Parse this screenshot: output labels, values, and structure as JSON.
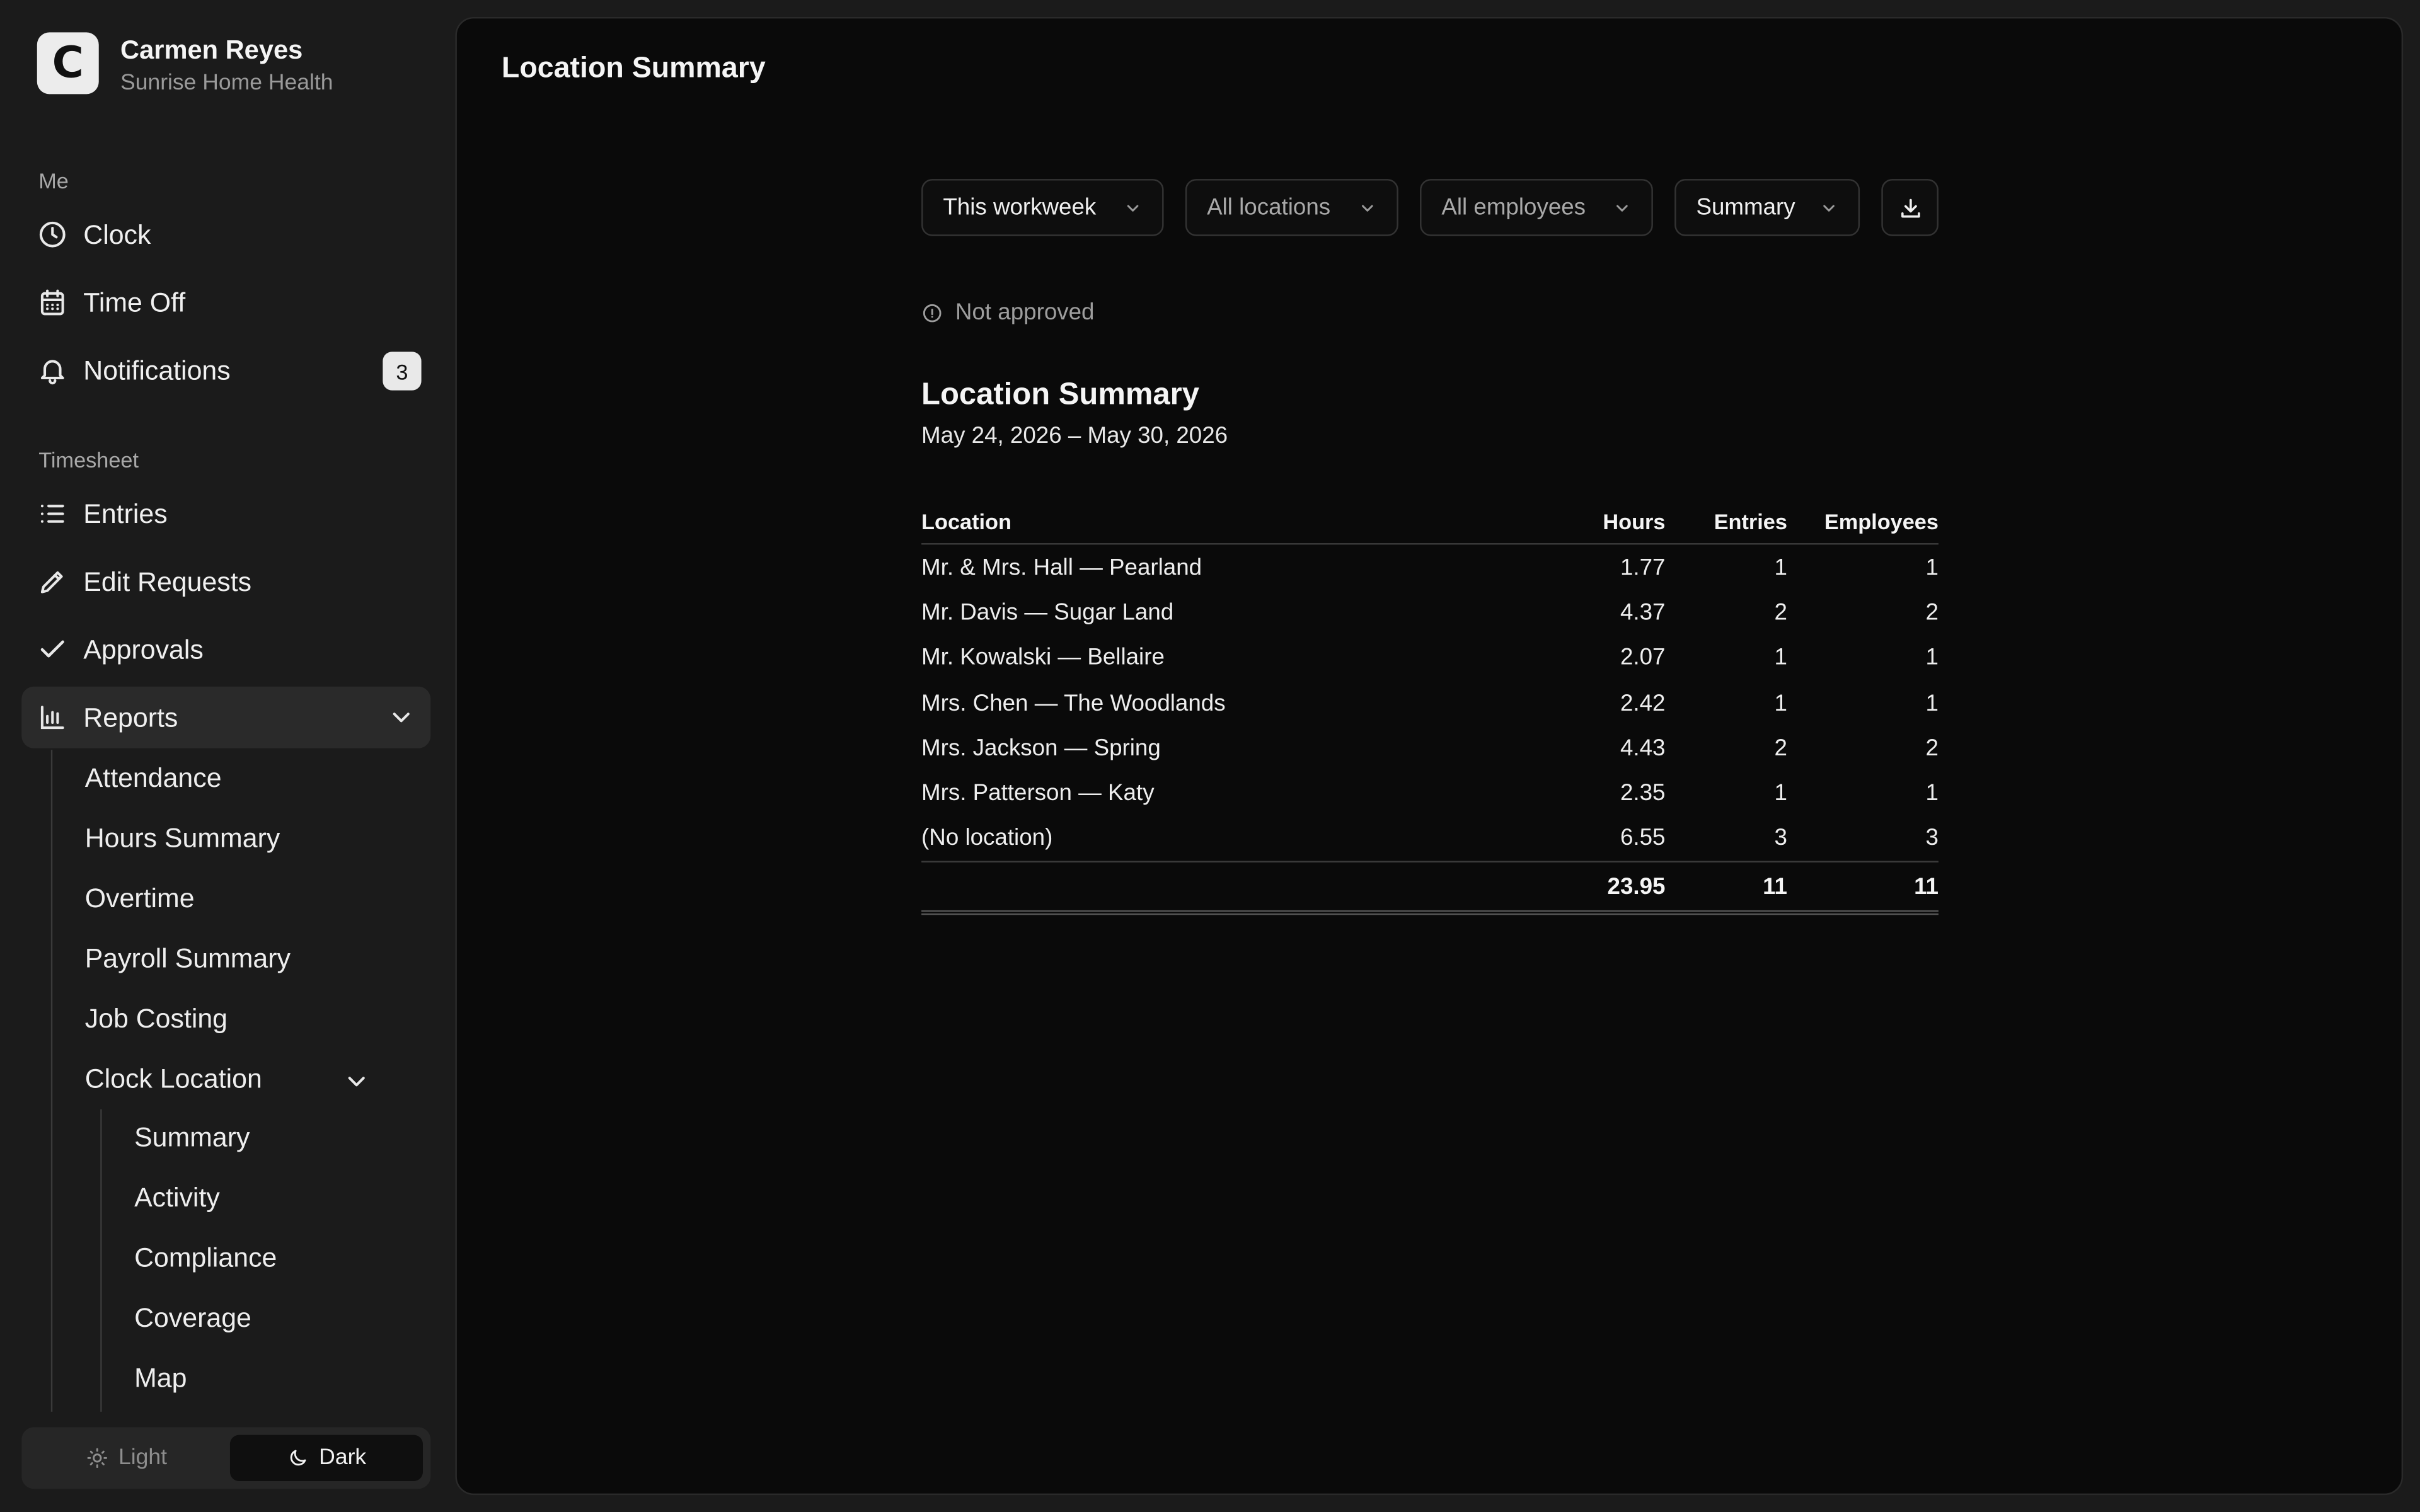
{
  "brand": {
    "logo_letter": "C",
    "user_name": "Carmen Reyes",
    "org_name": "Sunrise Home Health"
  },
  "sidebar": {
    "section_me": "Me",
    "me_items": [
      {
        "label": "Clock",
        "icon": "clock-icon"
      },
      {
        "label": "Time Off",
        "icon": "calendar-icon"
      },
      {
        "label": "Notifications",
        "icon": "bell-icon",
        "badge": "3"
      }
    ],
    "section_timesheet": "Timesheet",
    "timesheet_items": [
      {
        "label": "Entries",
        "icon": "list-icon"
      },
      {
        "label": "Edit Requests",
        "icon": "pencil-icon"
      },
      {
        "label": "Approvals",
        "icon": "check-icon"
      },
      {
        "label": "Reports",
        "icon": "bar-chart-icon",
        "expanded": true
      }
    ],
    "report_items": [
      "Attendance",
      "Hours Summary",
      "Overtime",
      "Payroll Summary",
      "Job Costing"
    ],
    "clock_location": {
      "label": "Clock Location",
      "expanded": true,
      "items": [
        "Summary",
        "Activity",
        "Compliance",
        "Coverage",
        "Map"
      ]
    },
    "theme": {
      "light_label": "Light",
      "dark_label": "Dark",
      "selected": "Dark"
    }
  },
  "main": {
    "page_title": "Location Summary",
    "filters": {
      "period": "This workweek",
      "locations": "All locations",
      "employees": "All employees",
      "view": "Summary"
    },
    "status": "Not approved",
    "report": {
      "title": "Location Summary",
      "date_range": "May 24, 2026 – May 30, 2026",
      "columns": {
        "location": "Location",
        "hours": "Hours",
        "entries": "Entries",
        "employees": "Employees"
      },
      "rows": [
        {
          "location": "Mr. & Mrs. Hall — Pearland",
          "hours": "1.77",
          "entries": "1",
          "employees": "1"
        },
        {
          "location": "Mr. Davis — Sugar Land",
          "hours": "4.37",
          "entries": "2",
          "employees": "2"
        },
        {
          "location": "Mr. Kowalski — Bellaire",
          "hours": "2.07",
          "entries": "1",
          "employees": "1"
        },
        {
          "location": "Mrs. Chen — The Woodlands",
          "hours": "2.42",
          "entries": "1",
          "employees": "1"
        },
        {
          "location": "Mrs. Jackson — Spring",
          "hours": "4.43",
          "entries": "2",
          "employees": "2"
        },
        {
          "location": "Mrs. Patterson — Katy",
          "hours": "2.35",
          "entries": "1",
          "employees": "1"
        },
        {
          "location": "(No location)",
          "hours": "6.55",
          "entries": "3",
          "employees": "3"
        }
      ],
      "totals": {
        "hours": "23.95",
        "entries": "11",
        "employees": "11"
      }
    }
  }
}
